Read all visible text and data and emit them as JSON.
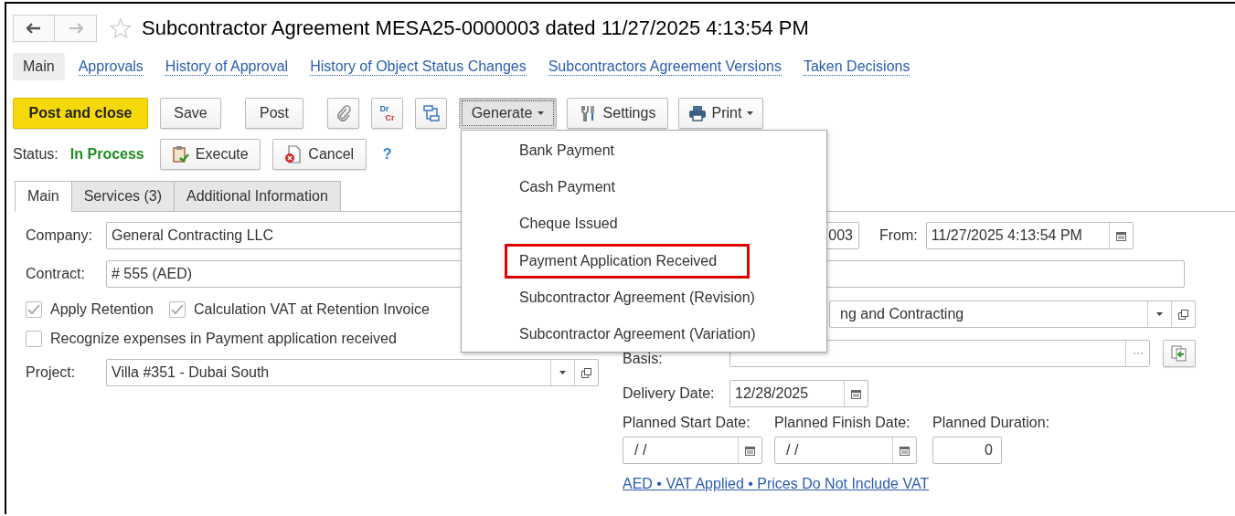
{
  "title": "Subcontractor Agreement MESA25-0000003 dated 11/27/2025 4:13:54 PM",
  "sections": [
    {
      "label": "Main",
      "selected": true
    },
    {
      "label": "Approvals",
      "selected": false
    },
    {
      "label": "History of Approval",
      "selected": false
    },
    {
      "label": "History of Object Status Changes",
      "selected": false
    },
    {
      "label": "Subcontractors Agreement Versions",
      "selected": false
    },
    {
      "label": "Taken Decisions",
      "selected": false
    }
  ],
  "toolbar": [
    {
      "kind": "primary",
      "label": "Post and close"
    },
    {
      "kind": "plain",
      "label": "Save"
    },
    {
      "kind": "plain",
      "label": "Post"
    },
    {
      "kind": "attach"
    },
    {
      "kind": "drcr",
      "top": "Dr",
      "bottom": "Cr"
    },
    {
      "kind": "structure"
    },
    {
      "kind": "menu",
      "label": "Generate",
      "pressed": true
    },
    {
      "kind": "settings",
      "label": "Settings"
    },
    {
      "kind": "print",
      "label": "Print"
    }
  ],
  "status": {
    "label": "Status:",
    "value": "In Process"
  },
  "status_buttons": [
    {
      "kind": "execute",
      "label": "Execute"
    },
    {
      "kind": "cancel",
      "label": "Cancel"
    }
  ],
  "help": "?",
  "tabs": [
    {
      "label": "Main",
      "selected": true
    },
    {
      "label": "Services (3)",
      "selected": false
    },
    {
      "label": "Additional Information",
      "selected": false
    }
  ],
  "company": {
    "label": "Company:",
    "value": "General Contracting LLC"
  },
  "number": {
    "value": "003"
  },
  "from": {
    "label": "From:",
    "value": "11/27/2025  4:13:54 PM"
  },
  "contract": {
    "label": "Contract:",
    "value": "# 555 (AED)"
  },
  "checks": [
    {
      "label": "Apply Retention",
      "checked": true
    },
    {
      "label": "Calculation VAT at Retention Invoice",
      "checked": true
    }
  ],
  "recognize": {
    "label": "Recognize expenses in Payment application received",
    "checked": false
  },
  "project": {
    "label": "Project:",
    "value": "Villa #351 - Dubai South"
  },
  "counterparty": {
    "value": "ng and Contracting"
  },
  "basis": {
    "label": "Basis:"
  },
  "delivery": {
    "label": "Delivery Date:",
    "value": "12/28/2025"
  },
  "planned": [
    {
      "kind": "date",
      "label": "Planned Start Date:",
      "value": "/  /"
    },
    {
      "kind": "date",
      "label": "Planned Finish Date:",
      "value": "/  /"
    },
    {
      "kind": "number",
      "label": "Planned Duration:",
      "value": "0"
    }
  ],
  "vat_link": "AED • VAT Applied • Prices Do Not Include VAT",
  "generate_menu": [
    {
      "label": "Bank Payment",
      "highlighted": false
    },
    {
      "label": "Cash Payment",
      "highlighted": false
    },
    {
      "label": "Cheque Issued",
      "highlighted": false
    },
    {
      "label": "Payment Application Received",
      "highlighted": true
    },
    {
      "label": "Subcontractor Agreement (Revision)",
      "highlighted": false
    },
    {
      "label": "Subcontractor Agreement (Variation)",
      "highlighted": false
    }
  ]
}
